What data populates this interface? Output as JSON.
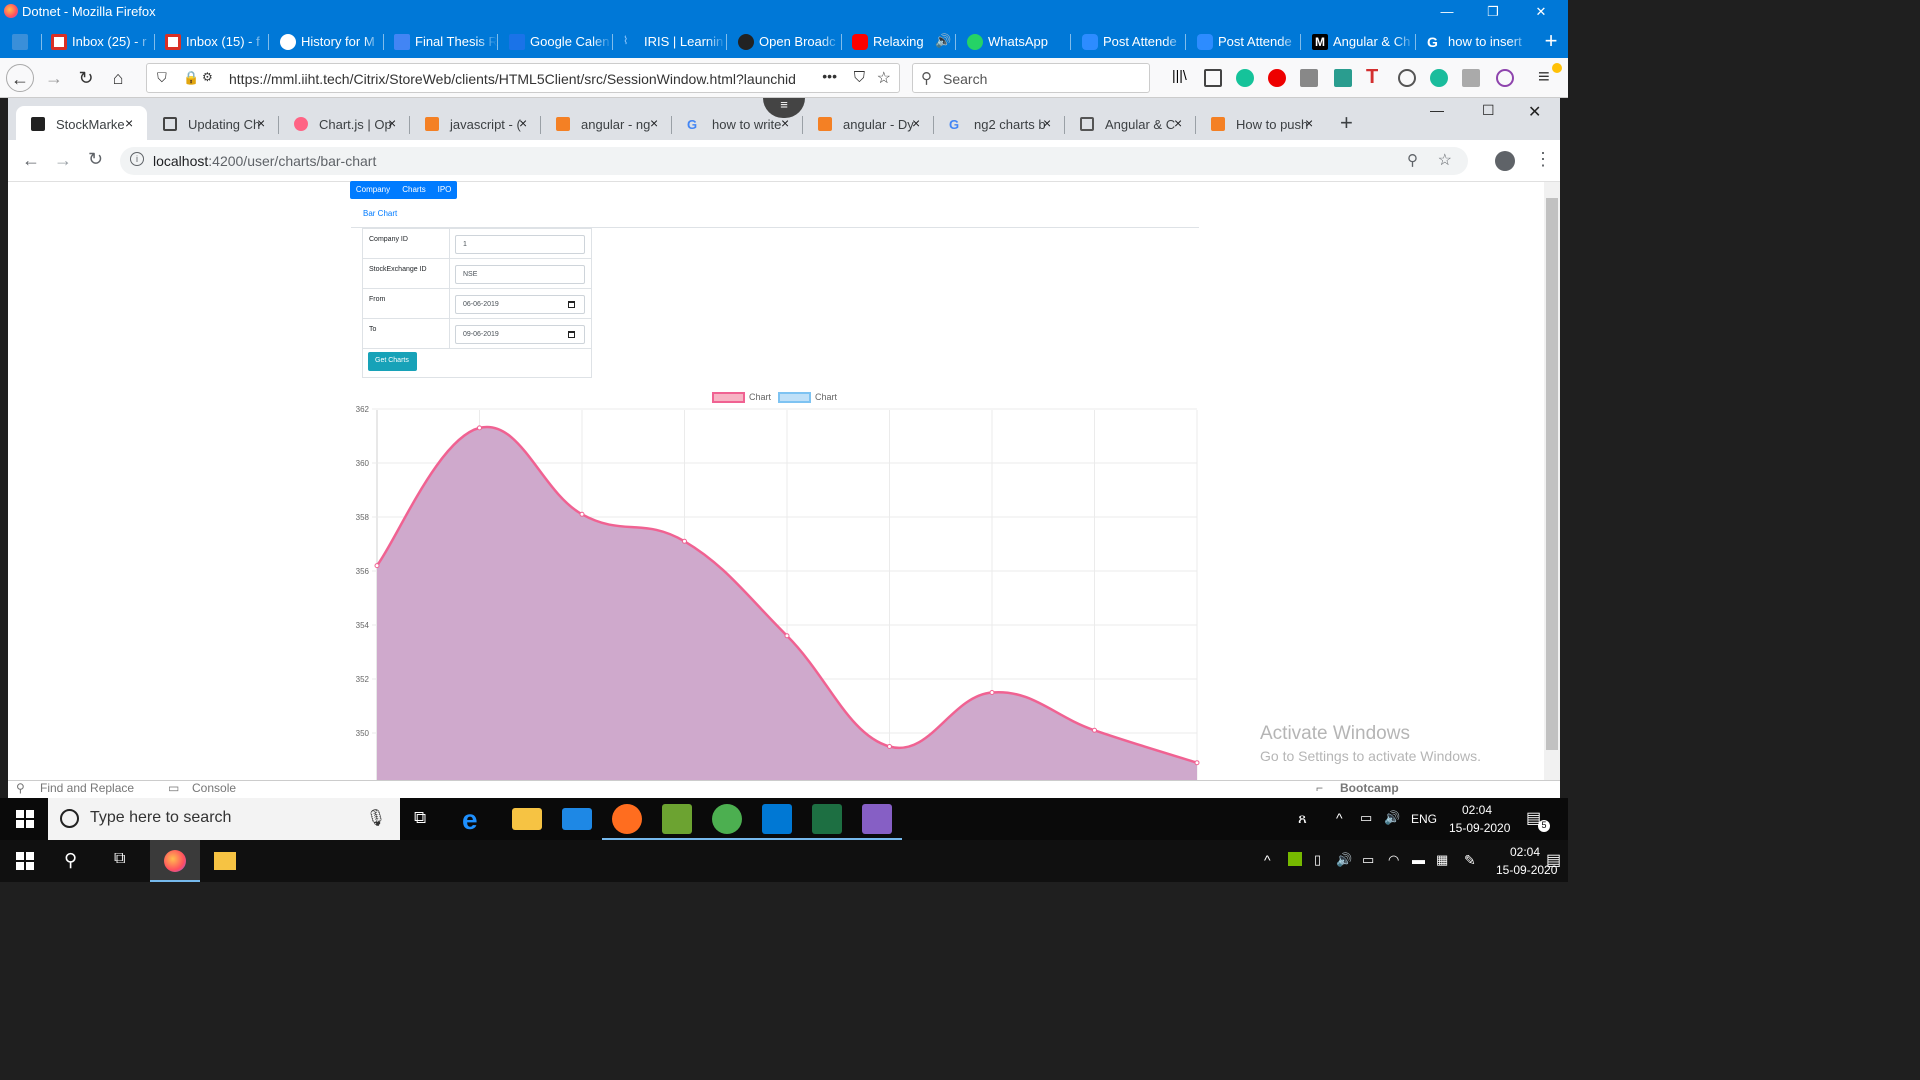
{
  "firefox": {
    "window_title": "Dotnet - Mozilla Firefox",
    "tabs": [
      {
        "label": "",
        "icon": "monitor-icon"
      },
      {
        "label": "Inbox (25) - r",
        "icon": "gmail-icon"
      },
      {
        "label": "Inbox (15) - f",
        "icon": "gmail-icon"
      },
      {
        "label": "History for M",
        "icon": "github-icon"
      },
      {
        "label": "Final Thesis R",
        "icon": "docs-icon"
      },
      {
        "label": "Google Calen",
        "icon": "calendar-icon"
      },
      {
        "label": "IRIS | Learnin",
        "icon": "iris-icon"
      },
      {
        "label": "Open Broadc",
        "icon": "obs-icon"
      },
      {
        "label": "Relaxing",
        "icon": "youtube-icon"
      },
      {
        "label": "WhatsApp",
        "icon": "whatsapp-icon"
      },
      {
        "label": "Post Attende",
        "icon": "zoom-icon"
      },
      {
        "label": "Post Attende",
        "icon": "zoom-icon"
      },
      {
        "label": "Angular & Ch",
        "icon": "medium-icon"
      },
      {
        "label": "how to insert",
        "icon": "google-icon"
      }
    ],
    "url": "https://mml.iiht.tech/Citrix/StoreWeb/clients/HTML5Client/src/SessionWindow.html?launchid",
    "url_domain": "iiht.tech",
    "search_placeholder": "Search",
    "more_label": "•••"
  },
  "chrome": {
    "tabs": [
      {
        "label": "StockMarke",
        "icon": "angular-icon",
        "active": true
      },
      {
        "label": "Updating Ch",
        "icon": "book-icon"
      },
      {
        "label": "Chart.js | Op",
        "icon": "chartjs-icon"
      },
      {
        "label": "javascript - (",
        "icon": "stackoverflow-icon"
      },
      {
        "label": "angular - ng",
        "icon": "stackoverflow-icon"
      },
      {
        "label": "how to write",
        "icon": "google-icon"
      },
      {
        "label": "angular - Dy",
        "icon": "stackoverflow-icon"
      },
      {
        "label": "ng2 charts b",
        "icon": "google-icon"
      },
      {
        "label": "Angular & C",
        "icon": "medium-icon"
      },
      {
        "label": "How to push",
        "icon": "stackoverflow-icon"
      }
    ],
    "url_host": "localhost",
    "url_path": ":4200/user/charts/bar-chart",
    "new_tab": "+",
    "close_glyph": "×"
  },
  "app": {
    "nav": [
      "Company",
      "Charts",
      "IPO"
    ],
    "breadcrumb": "Bar Chart",
    "form": {
      "company_id_label": "Company ID",
      "company_id_value": "1",
      "exchange_label": "StockExchange ID",
      "exchange_value": "NSE",
      "from_label": "From",
      "from_value": "06-06-2019",
      "to_label": "To",
      "to_value": "09-06-2019",
      "submit_label": "Get Charts"
    }
  },
  "chart_data": {
    "type": "area",
    "series": [
      {
        "name": "Chart",
        "color": "#f06292",
        "fill": "#cfa9cc",
        "values": [
          356.2,
          361.3,
          358.1,
          357.1,
          353.6,
          349.5,
          351.5,
          350.1,
          348.9
        ]
      },
      {
        "name": "Chart",
        "color": "#7ec3f2",
        "values": []
      }
    ],
    "x": [
      0,
      1,
      2,
      3,
      4,
      5,
      6,
      7,
      8
    ],
    "yticks": [
      350,
      352,
      354,
      356,
      358,
      360,
      362
    ],
    "ylim": [
      347.5,
      362
    ],
    "grid": true,
    "legend": "top"
  },
  "overlay": {
    "activate_title": "Activate Windows",
    "activate_sub": "Go to Settings to activate Windows."
  },
  "devtools_strip": {
    "find_label": "Find and Replace",
    "console_label": "Console",
    "bootcamp_label": "Bootcamp"
  },
  "taskbar_inner": {
    "search_placeholder": "Type here to search",
    "lang": "ENG",
    "time": "02:04",
    "date": "15-09-2020",
    "notif_count": "5"
  },
  "taskbar_outer": {
    "time": "02:04",
    "date": "15-09-2020"
  }
}
